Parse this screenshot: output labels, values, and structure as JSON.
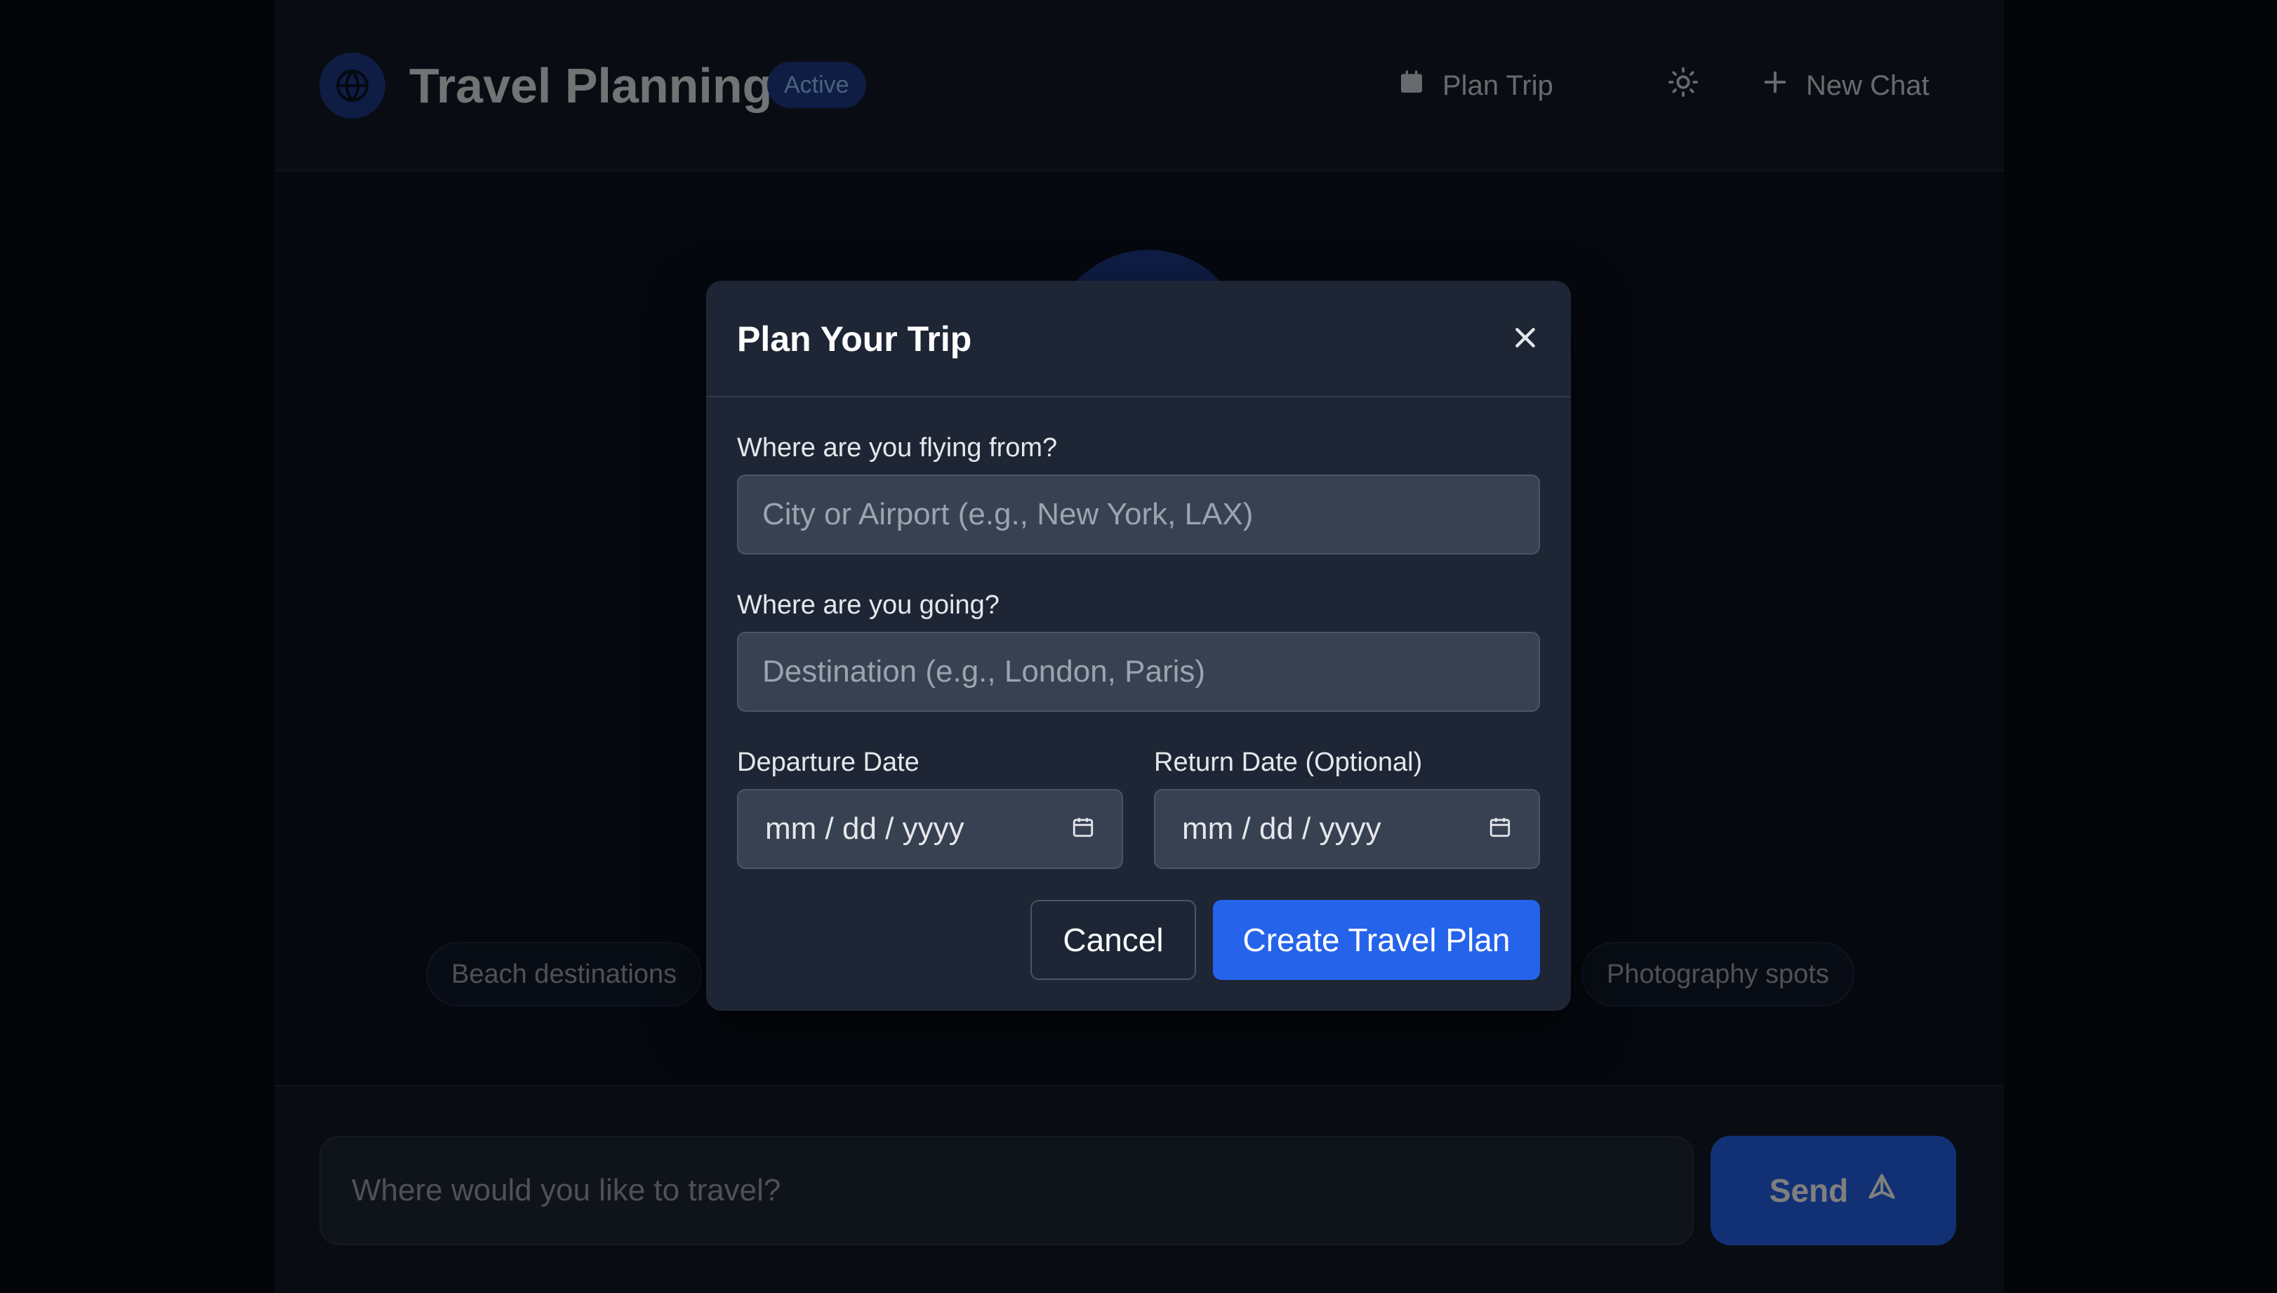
{
  "header": {
    "logo_icon": "globe-icon",
    "title": "Travel Planning",
    "status_badge": "Active",
    "plan_trip_label": "Plan Trip",
    "plan_trip_icon": "calendar-icon",
    "theme_icon": "sun-icon",
    "new_chat_label": "New Chat",
    "new_chat_icon": "plus-icon"
  },
  "suggestions": {
    "items": [
      "Beach destinations",
      "Photography spots"
    ]
  },
  "chat": {
    "input_placeholder": "Where would you like to travel?",
    "send_label": "Send",
    "send_icon": "send-icon"
  },
  "modal": {
    "title": "Plan Your Trip",
    "close_icon": "close-icon",
    "from_label": "Where are you flying from?",
    "from_placeholder": "City or Airport (e.g., New York, LAX)",
    "to_label": "Where are you going?",
    "to_placeholder": "Destination (e.g., London, Paris)",
    "departure_label": "Departure Date",
    "departure_value": "mm / dd / yyyy",
    "return_label": "Return Date (Optional)",
    "return_value": "mm / dd / yyyy",
    "cancel_label": "Cancel",
    "create_label": "Create Travel Plan"
  },
  "colors": {
    "accent": "#2563eb",
    "badge_bg": "#1e3a8a",
    "modal_bg": "#1e2635",
    "field_bg": "#374151"
  }
}
